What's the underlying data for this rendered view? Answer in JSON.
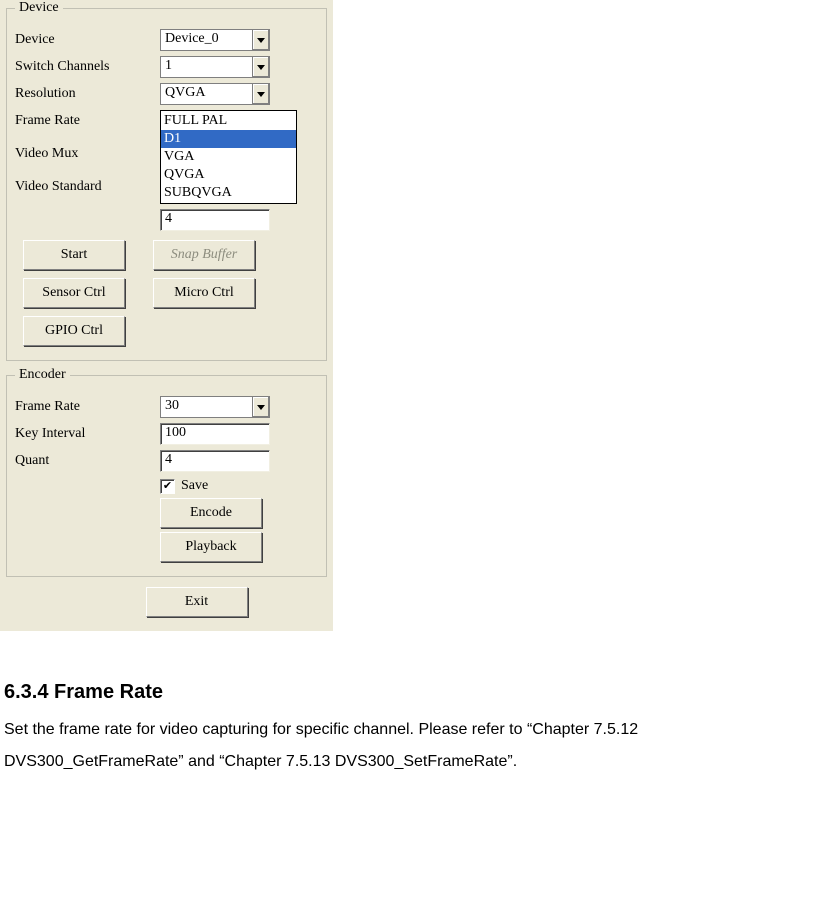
{
  "device_group": {
    "legend": "Device",
    "rows": {
      "device": {
        "label": "Device",
        "value": "Device_0"
      },
      "switch_channels": {
        "label": "Switch Channels",
        "value": "1"
      },
      "resolution": {
        "label": "Resolution",
        "value": "QVGA"
      },
      "frame_rate": {
        "label": "Frame Rate"
      },
      "video_mux": {
        "label": "Video Mux"
      },
      "video_standard": {
        "label": "Video Standard"
      },
      "extra_input": {
        "value": "4"
      }
    },
    "listbox": {
      "items": [
        "FULL PAL",
        "D1",
        "VGA",
        "QVGA",
        "SUBQVGA"
      ],
      "selected_index": 1
    },
    "buttons": {
      "start": "Start",
      "snap_buffer": "Snap Buffer",
      "sensor_ctrl": "Sensor Ctrl",
      "micro_ctrl": "Micro Ctrl",
      "gpio_ctrl": "GPIO Ctrl"
    }
  },
  "encoder_group": {
    "legend": "Encoder",
    "rows": {
      "frame_rate": {
        "label": "Frame Rate",
        "value": "30"
      },
      "key_interval": {
        "label": "Key Interval",
        "value": "100"
      },
      "quant": {
        "label": "Quant",
        "value": "4"
      }
    },
    "save_checkbox": {
      "label": "Save",
      "checked": true
    },
    "buttons": {
      "encode": "Encode",
      "playback": "Playback"
    }
  },
  "exit_button": "Exit",
  "doc": {
    "heading": "6.3.4 Frame Rate",
    "body": "Set the frame rate for video capturing for specific channel. Please refer to “Chapter 7.5.12 DVS300_GetFrameRate” and “Chapter 7.5.13 DVS300_SetFrameRate”."
  }
}
